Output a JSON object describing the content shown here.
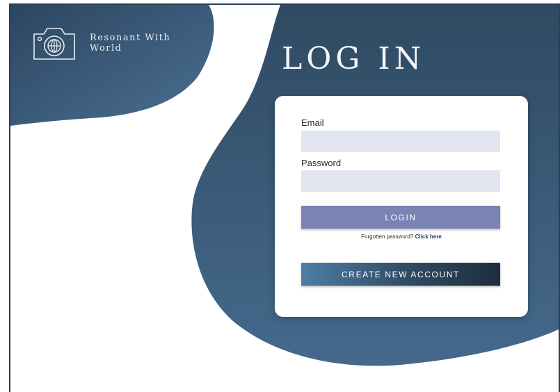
{
  "brand": {
    "name_line1": "Resonant With",
    "name_line2": "World",
    "logo_icon": "camera-globe-icon"
  },
  "page": {
    "title": "LOG IN"
  },
  "form": {
    "email_label": "Email",
    "email_value": "",
    "password_label": "Password",
    "password_value": "",
    "login_button": "LOGIN",
    "forgot_text": "Forgotten password?",
    "forgot_link": "Click here",
    "create_account_button": "CREATE NEW ACCOUNT"
  },
  "colors": {
    "brand_dark": "#2f4a63",
    "brand_mid": "#3f6285",
    "login_button": "#7a83b3",
    "input_bg": "#e2e4ef"
  }
}
